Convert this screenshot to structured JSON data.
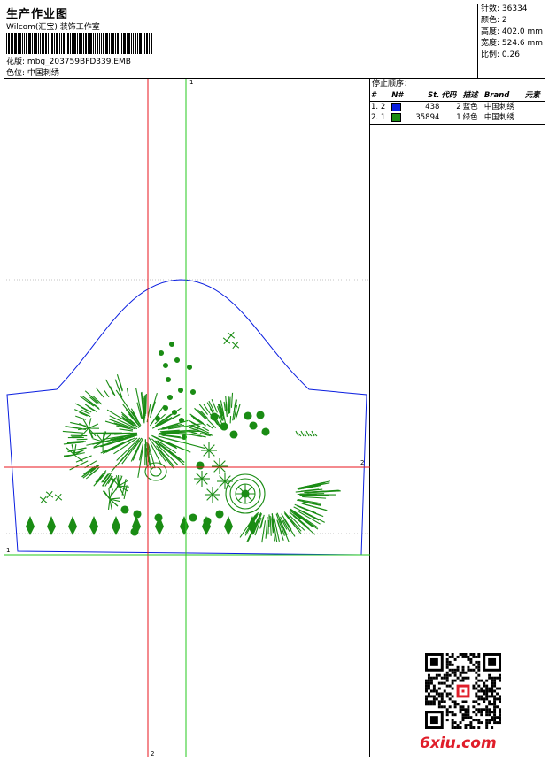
{
  "header": {
    "title": "生产作业图",
    "company": "Wilcom(汇宝) 装饰工作室",
    "file_label": "花版",
    "file_name": "mbg_203759BFD339.EMB",
    "color_label": "色位",
    "color_value": "中国刺绣"
  },
  "stats": {
    "stitches": "针数: 36334",
    "colors": "颜色: 2",
    "height": "高度: 402.0 mm",
    "width": "宽度: 524.6 mm",
    "scale": "比例: 0.26"
  },
  "stop_sequence": {
    "title": "停止顺序：",
    "headers": [
      "#",
      "N#",
      "St.",
      "代码",
      "描述",
      "Brand",
      "元素"
    ],
    "rows": [
      {
        "num": "1.",
        "needle": "2",
        "stitches": "438",
        "code": "2",
        "desc": "蓝色",
        "brand": "中国刺绣",
        "color": "#0a1ee0"
      },
      {
        "num": "2.",
        "needle": "1",
        "stitches": "35894",
        "code": "1",
        "desc": "绿色",
        "brand": "中国刺绣",
        "color": "#1a8c14"
      }
    ]
  },
  "axis_labels": {
    "top": "1",
    "bottom": "2",
    "left": "1",
    "right": "2"
  },
  "watermark": {
    "site": "6xiu.com"
  },
  "colors": {
    "outline": "#0a1ee0",
    "embroidery": "#1a8c14",
    "guide_red": "#e8141e",
    "guide_green": "#24c81e"
  }
}
